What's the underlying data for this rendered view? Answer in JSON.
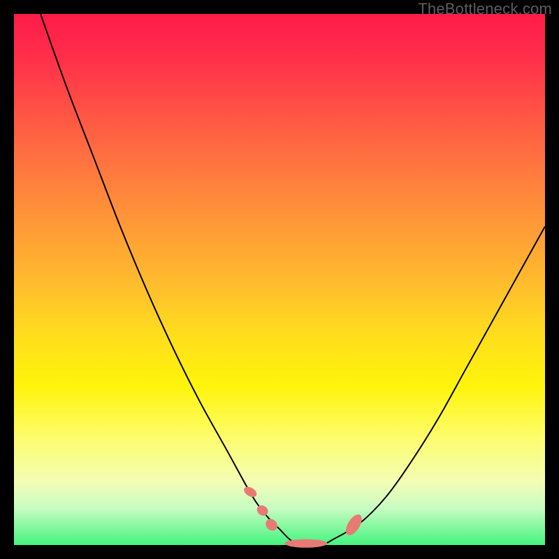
{
  "watermark": "TheBottleneck.com",
  "chart_data": {
    "type": "line",
    "title": "",
    "xlabel": "",
    "ylabel": "",
    "xlim": [
      0,
      100
    ],
    "ylim": [
      0,
      100
    ],
    "series": [
      {
        "name": "bottleneck-curve",
        "x": [
          5,
          10,
          15,
          20,
          25,
          30,
          35,
          40,
          45,
          48,
          50,
          52,
          54,
          56,
          58,
          60,
          65,
          70,
          75,
          80,
          85,
          90,
          95,
          100
        ],
        "y": [
          100,
          86,
          73,
          60,
          48,
          37,
          27,
          18,
          9,
          5,
          3,
          1,
          0,
          0,
          0,
          1,
          4,
          9,
          16,
          24,
          33,
          42,
          51,
          60
        ]
      }
    ],
    "markers": [
      {
        "cx": 44.5,
        "cy": 10.0,
        "rx": 0.8,
        "ry": 1.3,
        "angle": -60,
        "name": "marker-left-upper"
      },
      {
        "cx": 46.8,
        "cy": 6.5,
        "rx": 0.9,
        "ry": 1.1,
        "angle": -55,
        "name": "marker-left-mid"
      },
      {
        "cx": 48.5,
        "cy": 3.8,
        "rx": 1.0,
        "ry": 1.2,
        "angle": -45,
        "name": "marker-left-low"
      },
      {
        "cx": 55.0,
        "cy": 0.3,
        "rx": 4.0,
        "ry": 0.8,
        "angle": 0,
        "name": "marker-bottom-flat"
      },
      {
        "cx": 64.0,
        "cy": 3.8,
        "rx": 1.1,
        "ry": 2.2,
        "angle": 32,
        "name": "marker-right"
      }
    ],
    "background_gradient": {
      "top": "#ff1b4a",
      "upper_mid": "#ff9a36",
      "mid": "#ffdc1e",
      "lower_mid": "#fdfd6e",
      "bottom": "#44f47e"
    }
  }
}
